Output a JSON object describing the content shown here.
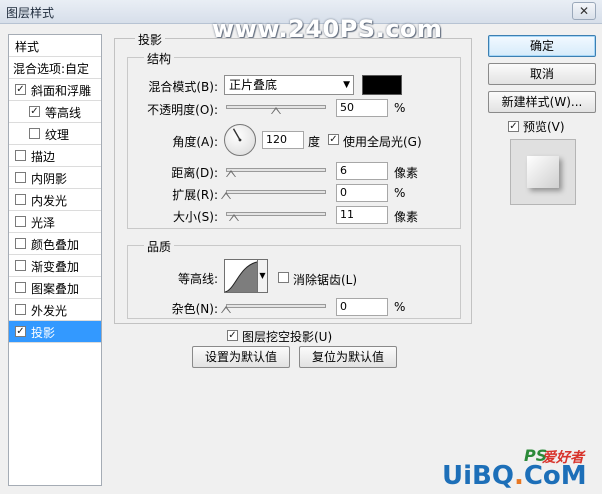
{
  "window": {
    "title": "图层样式",
    "watermark": "www.240PS.com",
    "close_glyph": "✕"
  },
  "style_list": {
    "header": "样式",
    "blend_options": "混合选项:自定",
    "items": [
      {
        "label": "斜面和浮雕",
        "checked": true,
        "indent": false,
        "selected": false
      },
      {
        "label": "等高线",
        "checked": true,
        "indent": true,
        "selected": false
      },
      {
        "label": "纹理",
        "checked": false,
        "indent": true,
        "selected": false
      },
      {
        "label": "描边",
        "checked": false,
        "indent": false,
        "selected": false
      },
      {
        "label": "内阴影",
        "checked": false,
        "indent": false,
        "selected": false
      },
      {
        "label": "内发光",
        "checked": false,
        "indent": false,
        "selected": false
      },
      {
        "label": "光泽",
        "checked": false,
        "indent": false,
        "selected": false
      },
      {
        "label": "颜色叠加",
        "checked": false,
        "indent": false,
        "selected": false
      },
      {
        "label": "渐变叠加",
        "checked": false,
        "indent": false,
        "selected": false
      },
      {
        "label": "图案叠加",
        "checked": false,
        "indent": false,
        "selected": false
      },
      {
        "label": "外发光",
        "checked": false,
        "indent": false,
        "selected": false
      },
      {
        "label": "投影",
        "checked": true,
        "indent": false,
        "selected": true
      }
    ]
  },
  "drop_shadow": {
    "title": "投影",
    "structure": {
      "title": "结构",
      "blend_mode_label": "混合模式(B):",
      "blend_mode_value": "正片叠底",
      "shadow_color": "#000000",
      "opacity_label": "不透明度(O):",
      "opacity_value": "50",
      "opacity_fraction": 0.5,
      "angle_label": "角度(A):",
      "angle_value": "120",
      "angle_unit": "度",
      "use_global_light": "使用全局光(G)",
      "use_global_light_checked": true,
      "distance_label": "距离(D):",
      "distance_value": "6",
      "distance_fraction": 0.05,
      "spread_label": "扩展(R):",
      "spread_value": "0",
      "spread_fraction": 0.0,
      "size_label": "大小(S):",
      "size_value": "11",
      "size_fraction": 0.08,
      "percent_unit": "%",
      "pixel_unit": "像素"
    },
    "quality": {
      "title": "品质",
      "contour_label": "等高线:",
      "anti_alias": "消除锯齿(L)",
      "anti_alias_checked": false,
      "noise_label": "杂色(N):",
      "noise_value": "0",
      "noise_fraction": 0.0,
      "percent_unit": "%"
    },
    "knockout": "图层挖空投影(U)",
    "knockout_checked": true,
    "set_default": "设置为默认值",
    "reset_default": "复位为默认值"
  },
  "buttons": {
    "ok": "确定",
    "cancel": "取消",
    "new_style": "新建样式(W)...",
    "preview": "预览(V)",
    "preview_checked": true
  },
  "logo": {
    "ps": "PS",
    "ps_cn": "爱好者",
    "site_prefix": "UiBQ",
    "site_dot": ".",
    "site_suffix": "CoM"
  }
}
